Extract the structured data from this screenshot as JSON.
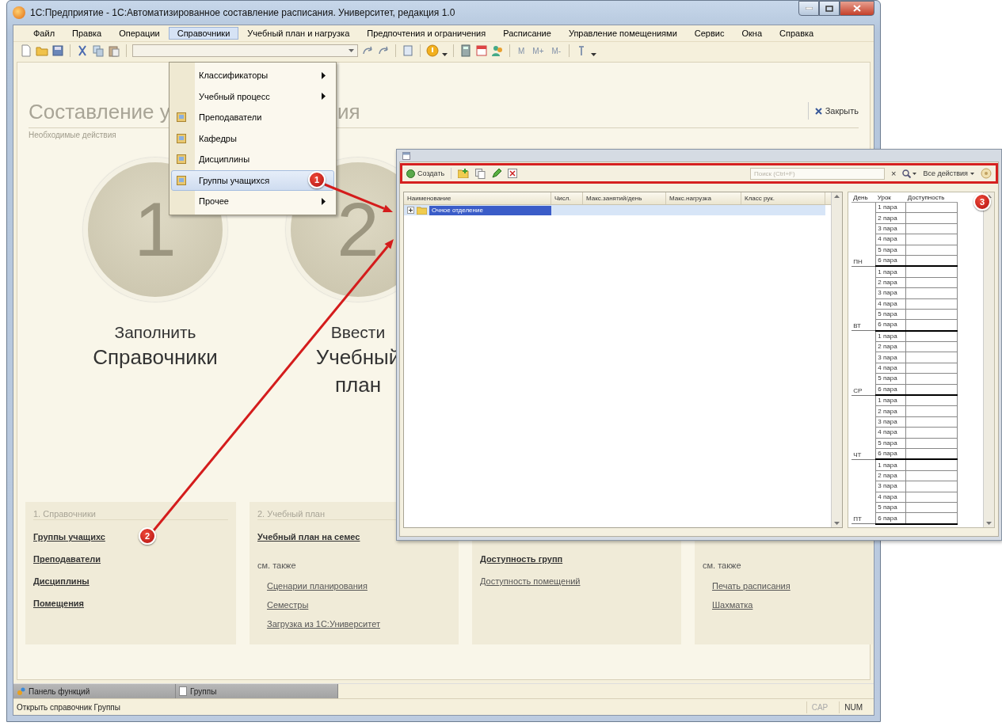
{
  "window": {
    "title": "1С:Предприятие - 1С:Автоматизированное составление расписания. Университет, редакция 1.0"
  },
  "menu_bar": [
    {
      "label": "Файл",
      "selected": false
    },
    {
      "label": "Правка",
      "selected": false
    },
    {
      "label": "Операции",
      "selected": false
    },
    {
      "label": "Справочники",
      "selected": true
    },
    {
      "label": "Учебный план и нагрузка",
      "selected": false
    },
    {
      "label": "Предпочтения и ограничения",
      "selected": false
    },
    {
      "label": "Расписание",
      "selected": false
    },
    {
      "label": "Управление помещениями",
      "selected": false
    },
    {
      "label": "Сервис",
      "selected": false
    },
    {
      "label": "Окна",
      "selected": false
    },
    {
      "label": "Справка",
      "selected": false
    }
  ],
  "toolbar": {
    "memory_buttons": [
      "M",
      "M+",
      "M-"
    ]
  },
  "dropdown_menu": [
    {
      "label": "Классификаторы",
      "kind": "submenu",
      "selected": false
    },
    {
      "label": "Учебный процесс",
      "kind": "submenu",
      "selected": false
    },
    {
      "label": "Преподаватели",
      "kind": "item",
      "selected": false
    },
    {
      "label": "Кафедры",
      "kind": "item",
      "selected": false
    },
    {
      "label": "Дисциплины",
      "kind": "item",
      "selected": false
    },
    {
      "label": "Группы учащихся",
      "kind": "item",
      "selected": true
    },
    {
      "label": "Прочее",
      "kind": "submenu",
      "selected": false
    }
  ],
  "content": {
    "title_parts": [
      "Составление у",
      "ия"
    ],
    "subtitle": "Необходимые действия",
    "close_button": "Закрыть",
    "steps": [
      {
        "number": "1",
        "lines": [
          "Заполнить",
          "Справочники"
        ]
      },
      {
        "number": "2",
        "lines": [
          "Ввести",
          "Учебный",
          "план"
        ]
      }
    ],
    "sections": [
      {
        "title": "1. Справочники",
        "links": [
          {
            "label": "Группы учащихс",
            "bold": true
          },
          {
            "label": "Преподаватели",
            "bold": true
          },
          {
            "label": "Дисциплины",
            "bold": true
          },
          {
            "label": "Помещения",
            "bold": true
          }
        ]
      },
      {
        "title": "2. Учебный план",
        "links": [
          {
            "label": "Учебный план на семес",
            "bold": true
          }
        ],
        "see_also": "см. также",
        "see_also_links": [
          "Сценарии планирования",
          "Семестры",
          "Загрузка из 1С:Университет"
        ]
      },
      {
        "links": [
          {
            "label": "Доступность групп",
            "bold": true
          },
          {
            "label": "Доступность помещений",
            "bold": false
          }
        ]
      },
      {
        "see_also": "см. также",
        "see_also_links": [
          "Печать расписания",
          "Шахматка"
        ]
      }
    ]
  },
  "taskbar": [
    {
      "label": "Панель функций",
      "kind": "panel"
    },
    {
      "label": "Группы",
      "kind": "document"
    }
  ],
  "status_bar": {
    "text": "Открыть справочник Группы",
    "indicators": [
      {
        "label": "CAP",
        "on": false
      },
      {
        "label": "NUM",
        "on": true
      }
    ]
  },
  "groups_window": {
    "toolbar": {
      "create_button": "Создать",
      "search_placeholder": "Поиск (Ctrl+F)",
      "clear_button": "×",
      "all_actions": "Все действия"
    },
    "table": {
      "columns": [
        "Наименование",
        "Числ.",
        "Макс.занятий/день",
        "Макс.нагрузка",
        "Класс рук."
      ],
      "rows": [
        {
          "name": "Очное отделение",
          "selected": true,
          "expanded": false
        }
      ]
    },
    "schedule": {
      "columns": [
        "День",
        "Урок",
        "Доступность"
      ],
      "days": [
        {
          "day": "ПН",
          "lessons": [
            "1 пара",
            "2 пара",
            "3 пара",
            "4 пара",
            "5 пара",
            "6 пара"
          ]
        },
        {
          "day": "ВТ",
          "lessons": [
            "1 пара",
            "2 пара",
            "3 пара",
            "4 пара",
            "5 пара",
            "6 пара"
          ]
        },
        {
          "day": "СР",
          "lessons": [
            "1 пара",
            "2 пара",
            "3 пара",
            "4 пара",
            "5 пара",
            "6 пара"
          ]
        },
        {
          "day": "ЧТ",
          "lessons": [
            "1 пара",
            "2 пара",
            "3 пара",
            "4 пара",
            "5 пара",
            "6 пара"
          ]
        },
        {
          "day": "ПТ",
          "lessons": [
            "1 пара",
            "2 пара",
            "3 пара",
            "4 пара",
            "5 пара",
            "6 пара"
          ]
        }
      ]
    }
  },
  "callouts": [
    "1",
    "2",
    "3"
  ]
}
